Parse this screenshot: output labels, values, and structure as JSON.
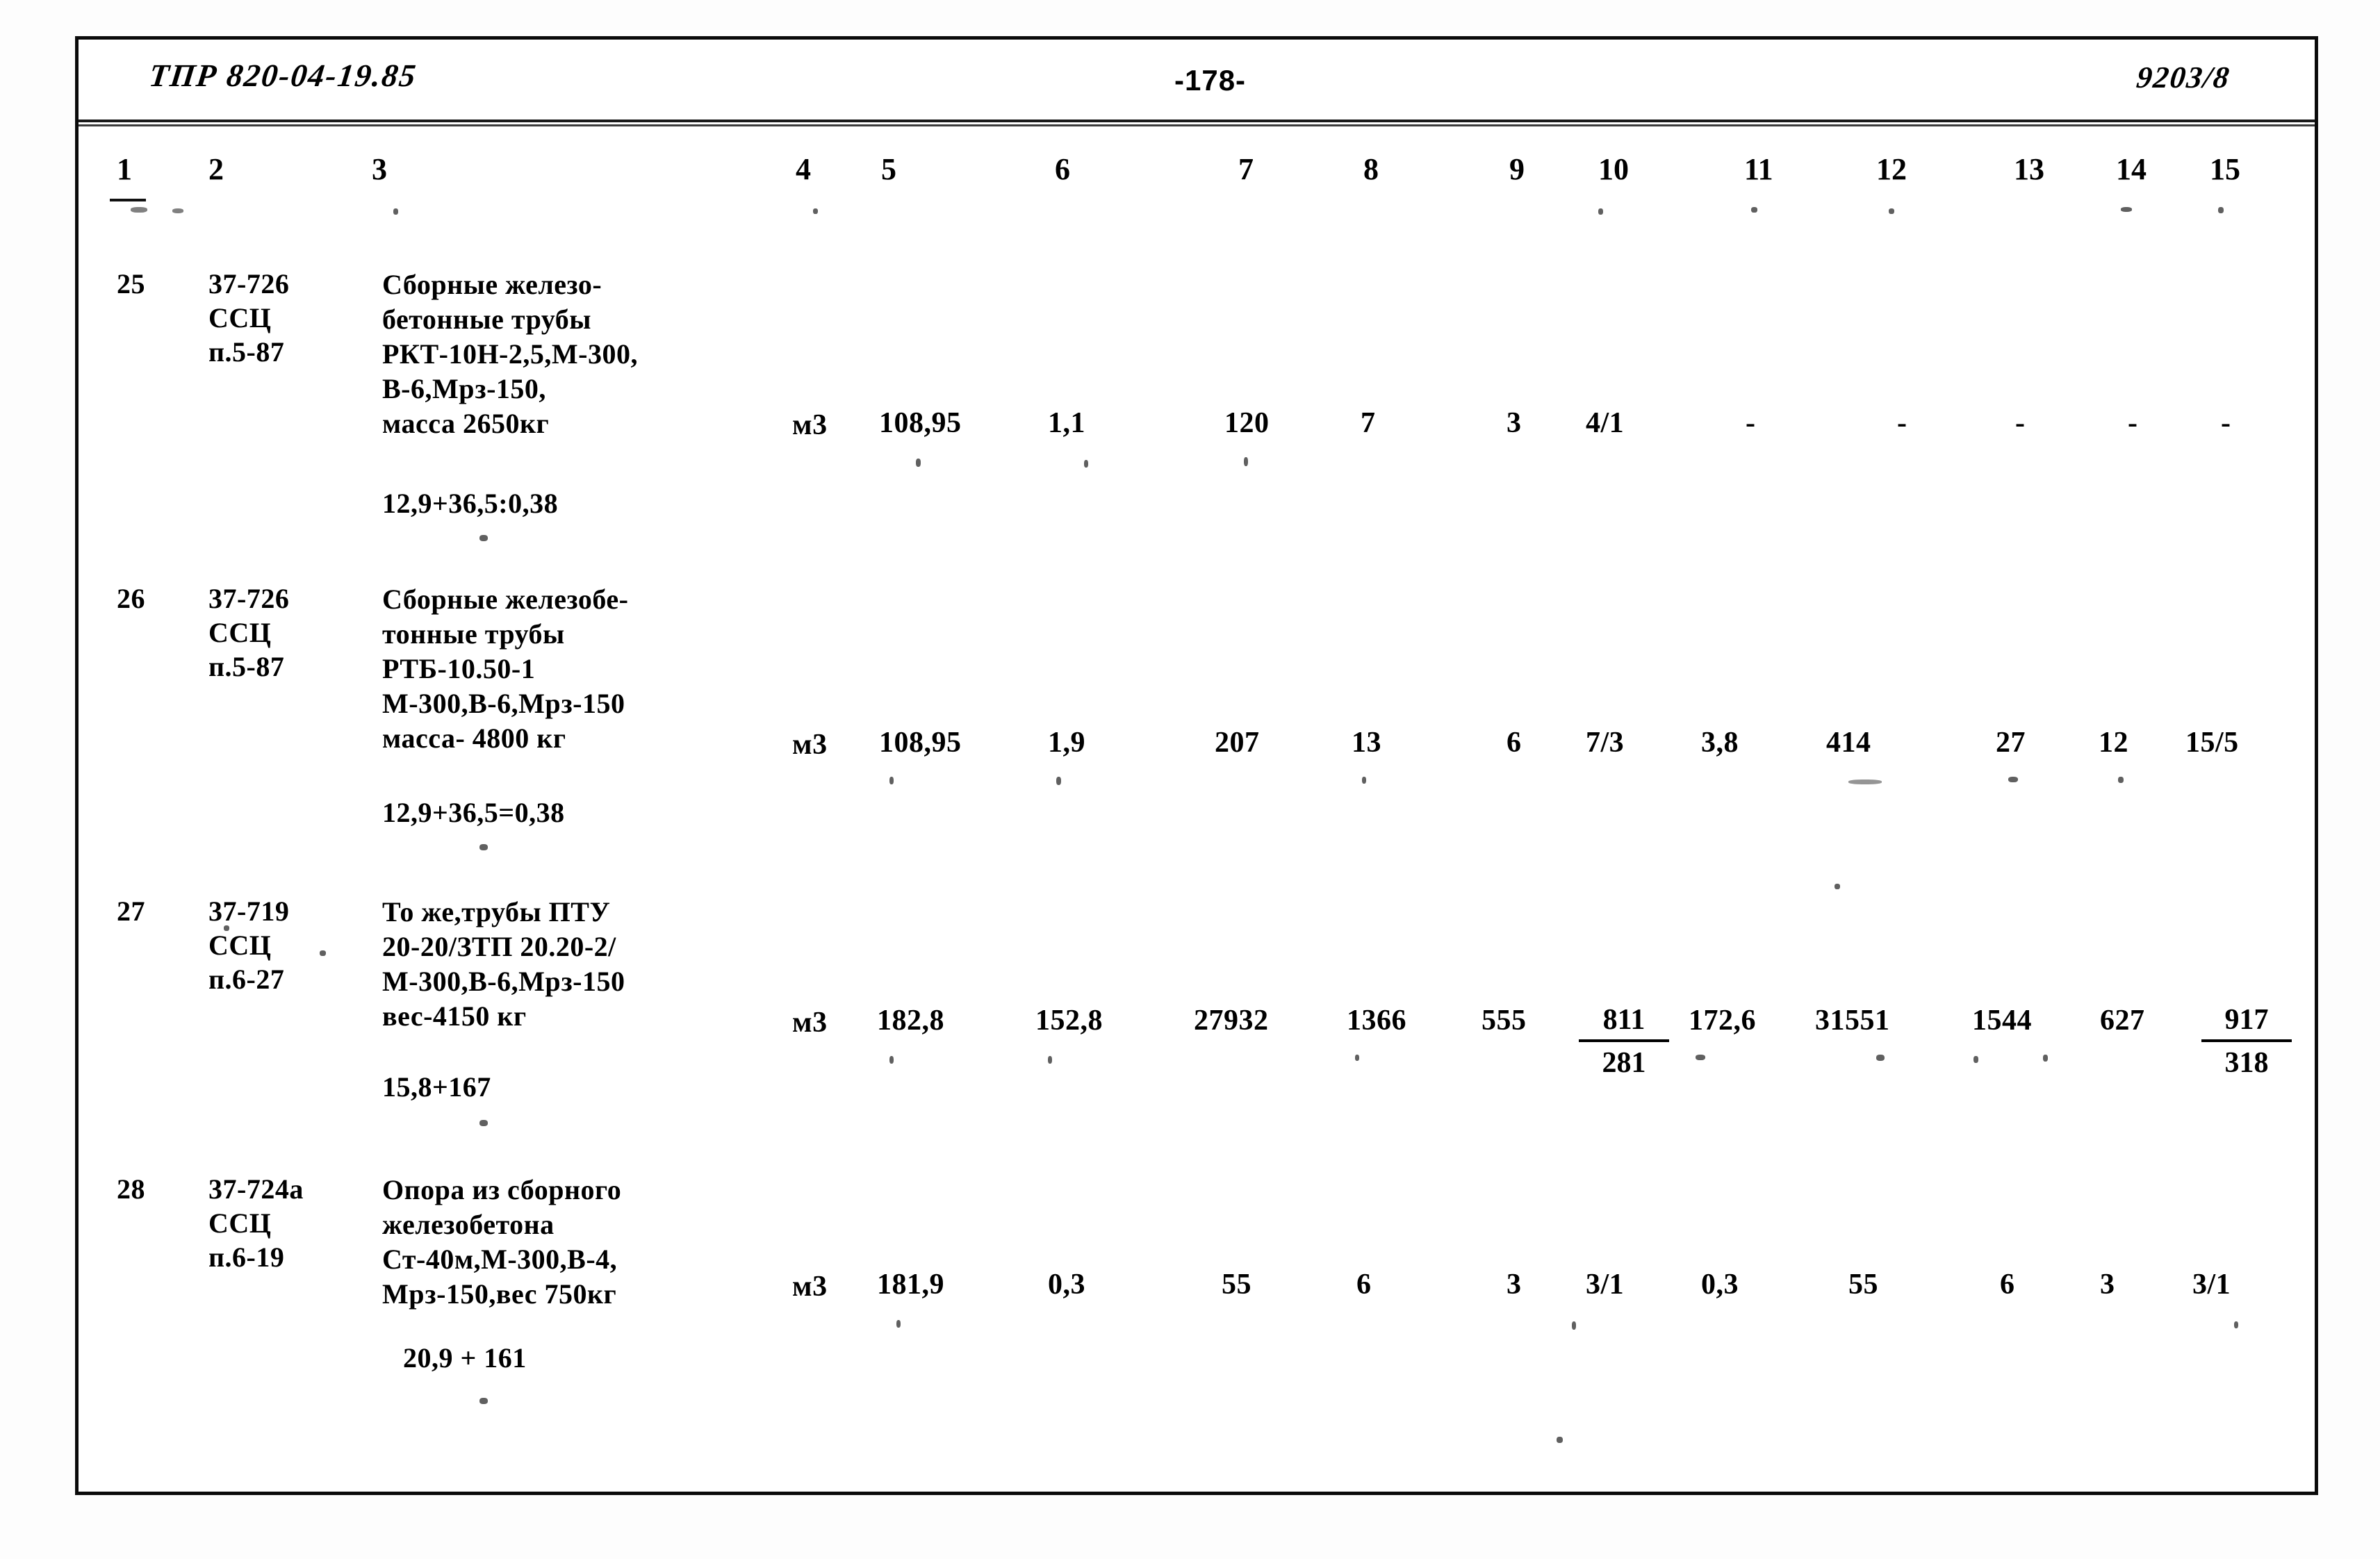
{
  "document": {
    "header_code": "ТПР 820-04-19.85",
    "page_number": "-178-",
    "sheet_code": "9203/8"
  },
  "table": {
    "column_headers": [
      "1",
      "2",
      "3",
      "4",
      "5",
      "6",
      "7",
      "8",
      "9",
      "10",
      "11",
      "12",
      "13",
      "14",
      "15"
    ],
    "rows": [
      {
        "num": "25",
        "code_lines": [
          "37-726",
          "ССЦ",
          "п.5-87"
        ],
        "description": "Сборные железо-\nбетонные трубы\nРКТ-10Н-2,5,М-300,\nВ-6,Мрз-150,\nмасса 2650кг",
        "formula": "12,9+36,5:0,38",
        "unit": "м3",
        "c5": "108,95",
        "c6": "1,1",
        "c7": "120",
        "c8": "7",
        "c9": "3",
        "c10": "4/1",
        "c11": "-",
        "c12": "-",
        "c13": "-",
        "c14": "-",
        "c15": "-"
      },
      {
        "num": "26",
        "code_lines": [
          "37-726",
          "ССЦ",
          "п.5-87"
        ],
        "description": "Сборные железобе-\nтонные трубы\nРТБ-10.50-1\nМ-300,В-6,Мрз-150\nмасса- 4800 кг",
        "formula": "12,9+36,5=0,38",
        "unit": "м3",
        "c5": "108,95",
        "c6": "1,9",
        "c7": "207",
        "c8": "13",
        "c9": "6",
        "c10": "7/3",
        "c11": "3,8",
        "c12": "414",
        "c13": "27",
        "c14": "12",
        "c15": "15/5"
      },
      {
        "num": "27",
        "code_lines": [
          "37-719",
          "ССЦ",
          "п.6-27"
        ],
        "description": "То же,трубы ПТУ\n20-20/ЗТП 20.20-2/\nМ-300,В-6,Мрз-150\nвес-4150 кг",
        "formula": "15,8+167",
        "unit": "м3",
        "c5": "182,8",
        "c6": "152,8",
        "c7": "27932",
        "c8": "1366",
        "c9": "555",
        "c10_top": "811",
        "c10_bot": "281",
        "c11": "172,6",
        "c12": "31551",
        "c13": "1544",
        "c14": "627",
        "c15_top": "917",
        "c15_bot": "318"
      },
      {
        "num": "28",
        "code_lines": [
          "37-724а",
          "ССЦ",
          "п.6-19"
        ],
        "description": "Опора из сборного\nжелезобетона\nСт-40м,М-300,В-4,\nМрз-150,вес 750кг",
        "formula": "20,9 + 161",
        "unit": "м3",
        "c5": "181,9",
        "c6": "0,3",
        "c7": "55",
        "c8": "6",
        "c9": "3",
        "c10": "3/1",
        "c11": "0,3",
        "c12": "55",
        "c13": "6",
        "c14": "3",
        "c15": "3/1"
      }
    ]
  }
}
